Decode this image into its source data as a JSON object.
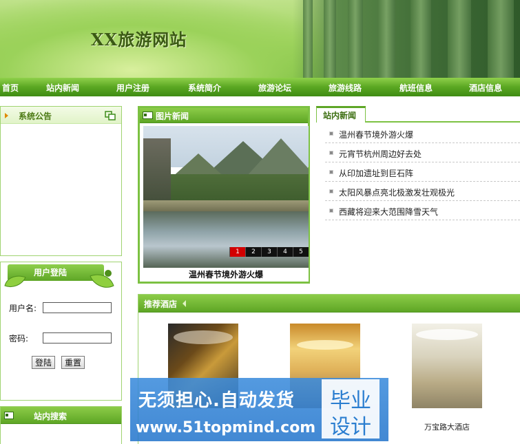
{
  "site": {
    "title": "XX旅游网站"
  },
  "nav": {
    "items": [
      "首页",
      "站内新闻",
      "用户注册",
      "系统简介",
      "旅游论坛",
      "旅游线路",
      "航班信息",
      "酒店信息"
    ]
  },
  "announcement": {
    "title": "系统公告"
  },
  "login": {
    "title": "用户登陆",
    "username_label": "用户名:",
    "password_label": "密码:",
    "login_button": "登陆",
    "reset_button": "重置"
  },
  "search": {
    "title": "站内搜索"
  },
  "photo_news": {
    "title": "图片新闻",
    "caption": "温州春节境外游火爆",
    "pages": [
      "1",
      "2",
      "3",
      "4",
      "5"
    ],
    "active_page": "1"
  },
  "site_news": {
    "title": "站内新闻",
    "items": [
      "温州春节境外游火爆",
      "元宵节杭州周边好去处",
      "从印加遗址到巨石阵",
      "太阳风暴点亮北极激发壮观极光",
      "西藏将迎来大范围降雪天气"
    ]
  },
  "hotels": {
    "title": "推荐酒店",
    "items": [
      {
        "name": ""
      },
      {
        "name": ""
      },
      {
        "name": "万宝路大酒店"
      }
    ]
  },
  "watermark": {
    "line1": "无须担心.自动发货",
    "line2": "www.51topmind.com",
    "badge_top": "毕业",
    "badge_bottom": "设计"
  },
  "colors": {
    "brand_green": "#5ea626",
    "nav_text": "#ffffff",
    "active_page": "#d20000"
  }
}
